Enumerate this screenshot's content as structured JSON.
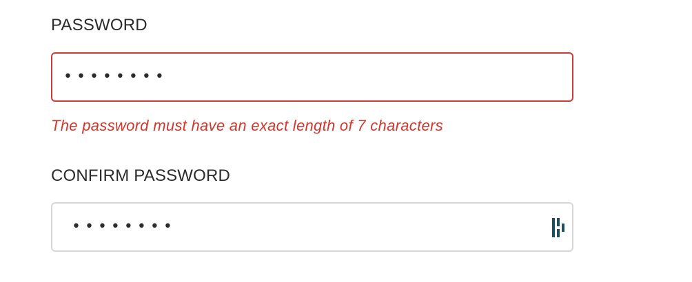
{
  "password": {
    "label": "PASSWORD",
    "value": "••••••••",
    "error": "The password must have an exact length of 7 characters"
  },
  "confirm_password": {
    "label": "CONFIRM PASSWORD",
    "value": "••••••••",
    "manager_icon": "password-manager-icon"
  },
  "colors": {
    "error": "#d3362d",
    "error_border": "#cc3b3b",
    "default_border": "#d7d7d7",
    "label_text": "#2b2b2b",
    "manager_icon": "#1f4f5f"
  }
}
